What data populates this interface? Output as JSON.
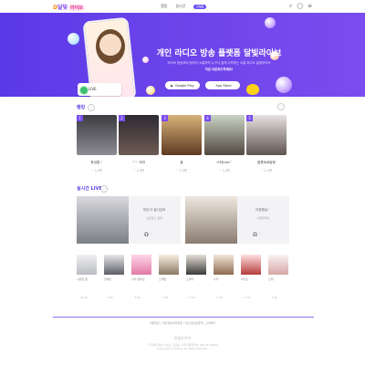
{
  "header": {
    "logo_prefix": "D",
    "logo_text": "달빛",
    "logo_pill": "라이브",
    "nav": [
      "랭킹",
      "실시간",
      "FAN"
    ],
    "icons": [
      "search-icon",
      "user-icon",
      "menu-icon"
    ]
  },
  "hero": {
    "title": "개인 라디오 방송 플랫폼 달빛라이브",
    "subtitle": "라이브 방송부터 청취자 소통까지 누구나 쉽게 시작하는 소통 라디오 달빛라이브",
    "subtitle2": "지금 다운로드하세요!",
    "card_name": "LIVE",
    "google_play": "Google Play",
    "app_store": "App Store"
  },
  "ranking": {
    "title": "랭킹",
    "items": [
      {
        "rank": "1",
        "name": "한성훈♡",
        "stat": "♡ 1.5만"
      },
      {
        "rank": "2",
        "name": "♡♡ 야지",
        "stat": "♡ 1.4만"
      },
      {
        "rank": "3",
        "name": "둥",
        "stat": "♡ 1.3만"
      },
      {
        "rank": "4",
        "name": "스타Live♡",
        "stat": "♡ 1.2만"
      },
      {
        "rank": "5",
        "name": "알콩트로팅팅",
        "stat": "♡ 1.1만"
      }
    ]
  },
  "live": {
    "title": "실시간 LIVE",
    "cards": [
      {
        "title": "게임 다 끝나셨죠",
        "user": "스트레스_만화"
      },
      {
        "title": "아침햇살~",
        "user": "시원한커피"
      }
    ],
    "small": [
      {
        "name": "시원한 밤",
        "stat": "♡ 12.4K"
      },
      {
        "name": "연예인",
        "stat": "♡ 9.8K"
      },
      {
        "name": "같이 들어요",
        "stat": "♡ 8.1K"
      },
      {
        "name": "노래방",
        "stat": "♡ 7.6K"
      },
      {
        "name": "드라마",
        "stat": "♡ 6.9K"
      },
      {
        "name": "수다",
        "stat": "♡ 5.5K"
      },
      {
        "name": "라디오",
        "stat": "♡ 4.2K"
      },
      {
        "name": "노래",
        "stat": "♡ 3.9K"
      }
    ]
  },
  "footer": {
    "links": "이용약관 | 개인정보처리방침 | 청소년보호정책 | 고객센터",
    "logo": "달빛라이브",
    "info1": "(주)달빛라이브 | 대표: 홍길동 | 사업자등록번호: 000-00-00000",
    "info2": "Copyright © Dallive. All rights reserved."
  }
}
